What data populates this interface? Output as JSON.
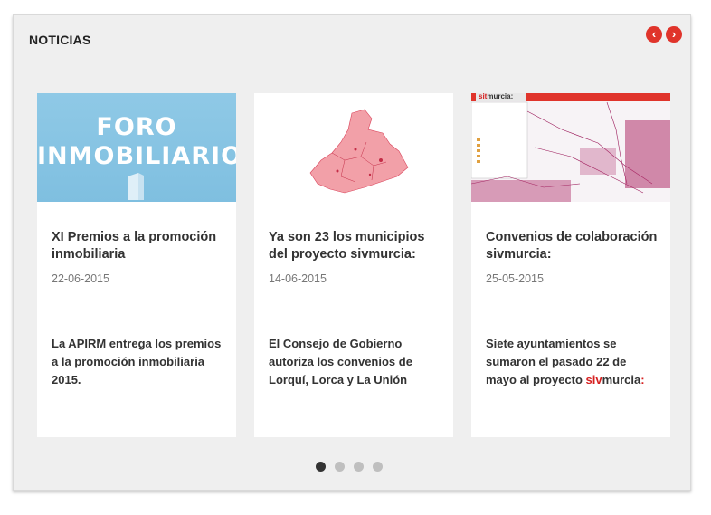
{
  "panel": {
    "title": "NOTICIAS",
    "prev_icon": "chevron-left-icon",
    "next_icon": "chevron-right-icon",
    "prev_glyph": "‹",
    "next_glyph": "›"
  },
  "cards": [
    {
      "image_line1": "FORO",
      "image_line2": "INMOBILIARIO",
      "title": "XI Premios a la promoción inmobiliaria",
      "date": "22-06-2015",
      "summary": "La APIRM entrega los premios a la promoción inmobiliaria 2015."
    },
    {
      "title": "Ya son 23 los municipios del proyecto sivmurcia:",
      "date": "14-06-2015",
      "summary": "El Consejo de Gobierno autoriza los convenios de Lorquí, Lorca y La Unión"
    },
    {
      "image_logo_a": "sit",
      "image_logo_b": "murcia:",
      "title": "Convenios de colaboración sivmurcia:",
      "date": "25-05-2015",
      "summary_part1": "Siete ayuntamientos se sumaron el pasado 22 de mayo al proyecto ",
      "summary_part2": "siv",
      "summary_part3": "murcia",
      "summary_part4": ":"
    }
  ],
  "pagination": {
    "count": 4,
    "active": 1
  },
  "colors": {
    "accent": "#e0342b",
    "panel_bg": "#efefef",
    "map_pink": "#f2a0a8"
  }
}
